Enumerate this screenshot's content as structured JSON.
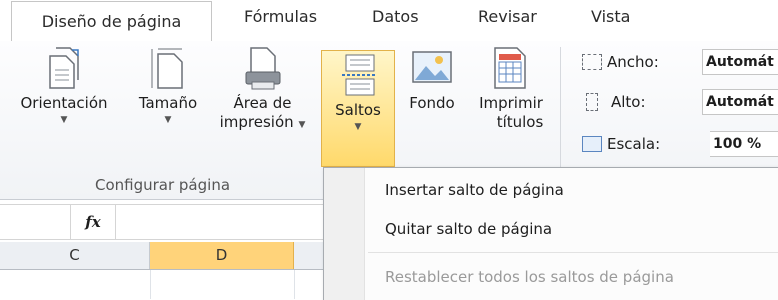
{
  "tabs": [
    {
      "label": "Diseño de página",
      "active": true
    },
    {
      "label": "Fórmulas"
    },
    {
      "label": "Datos"
    },
    {
      "label": "Revisar"
    },
    {
      "label": "Vista"
    }
  ],
  "ribbon": {
    "buttons": {
      "orientacion": "Orientación",
      "tamano": "Tamaño",
      "area_l1": "Área de",
      "area_l2": "impresión",
      "saltos": "Saltos",
      "fondo": "Fondo",
      "imprimir_l1": "Imprimir",
      "imprimir_l2": "títulos"
    },
    "group_label": "Configurar página",
    "scale": {
      "ancho_label": "Ancho:",
      "ancho_value": "Automát",
      "alto_label": "Alto:",
      "alto_value": "Automát",
      "escala_label": "Escala:",
      "escala_value": "100 %"
    }
  },
  "formula_bar": {
    "fx": "fx"
  },
  "columns": [
    "C",
    "D"
  ],
  "selected_column": "D",
  "menu": {
    "items": [
      {
        "label": "Insertar salto de página",
        "enabled": true
      },
      {
        "label": "Quitar salto de página",
        "enabled": true
      },
      {
        "label": "Restablecer todos los saltos de página",
        "enabled": false
      }
    ]
  },
  "colors": {
    "accent": "#ffd37a",
    "highlight_border": "#e2b24a"
  }
}
